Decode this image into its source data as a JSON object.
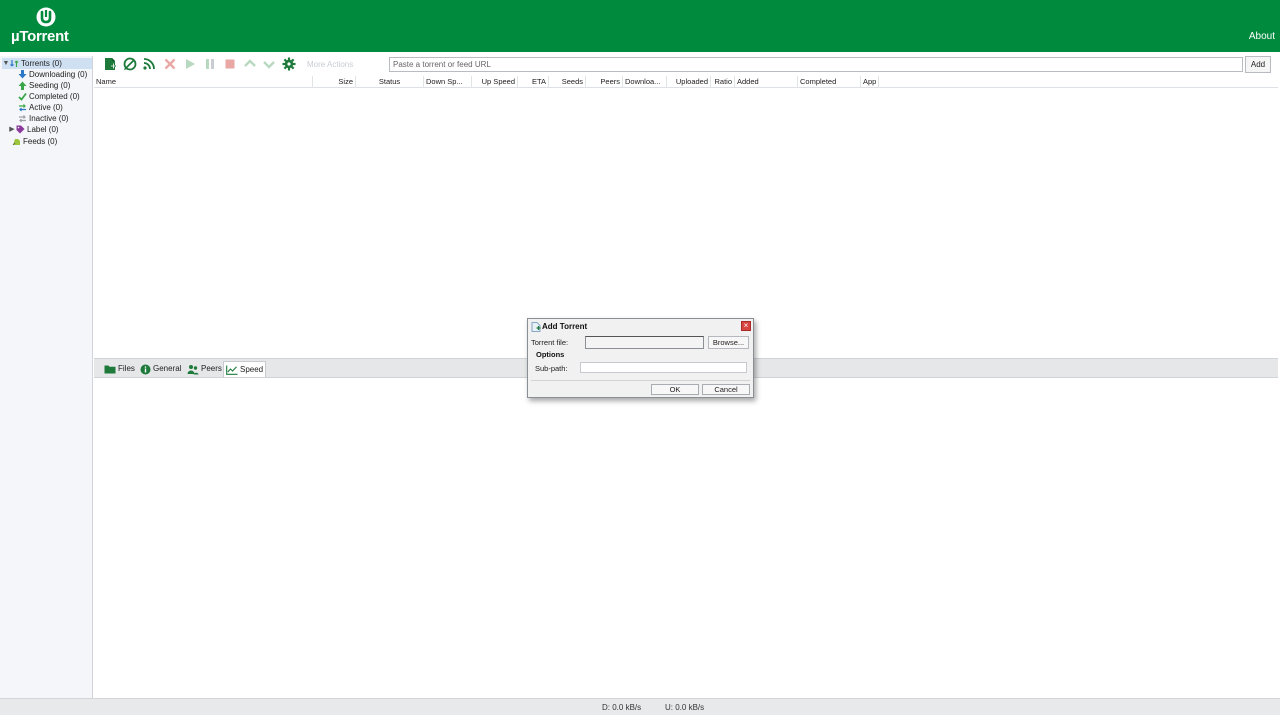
{
  "app": {
    "logo_text": "µTorrent",
    "about_label": "About"
  },
  "sidebar": {
    "items": [
      {
        "label": "Torrents (0)"
      },
      {
        "label": "Downloading (0)"
      },
      {
        "label": "Seeding (0)"
      },
      {
        "label": "Completed (0)"
      },
      {
        "label": "Active (0)"
      },
      {
        "label": "Inactive (0)"
      },
      {
        "label": "Label (0)"
      },
      {
        "label": "Feeds (0)"
      }
    ]
  },
  "toolbar": {
    "icons": [
      "add-torrent-icon",
      "add-url-icon",
      "add-rss-icon",
      "remove-icon",
      "start-icon",
      "pause-icon",
      "stop-icon",
      "move-up-icon",
      "move-down-icon",
      "settings-icon"
    ],
    "more_actions_label": "More Actions",
    "url_placeholder": "Paste a torrent or feed URL",
    "add_label": "Add"
  },
  "columns": [
    "Name",
    "Size",
    "Status",
    "Down Sp...",
    "Up Speed",
    "ETA",
    "Seeds",
    "Peers",
    "Downloa...",
    "Uploaded",
    "Ratio",
    "Added",
    "Completed",
    "App"
  ],
  "tabs": [
    {
      "label": "Files",
      "icon": "folder-icon"
    },
    {
      "label": "General",
      "icon": "info-icon"
    },
    {
      "label": "Peers",
      "icon": "peers-icon"
    },
    {
      "label": "Speed",
      "icon": "speed-chart-icon",
      "active": true
    }
  ],
  "status": {
    "down": "D: 0.0 kB/s",
    "up": "U: 0.0 kB/s"
  },
  "dialog": {
    "title": "Add Torrent",
    "close_glyph": "×",
    "torrent_file_label": "Torrent file:",
    "browse_label": "Browse...",
    "options_label": "Options",
    "subpath_label": "Sub-path:",
    "ok_label": "OK",
    "cancel_label": "Cancel"
  },
  "colors": {
    "brand_green": "#008a3e",
    "icon_green": "#1d7a3a"
  }
}
